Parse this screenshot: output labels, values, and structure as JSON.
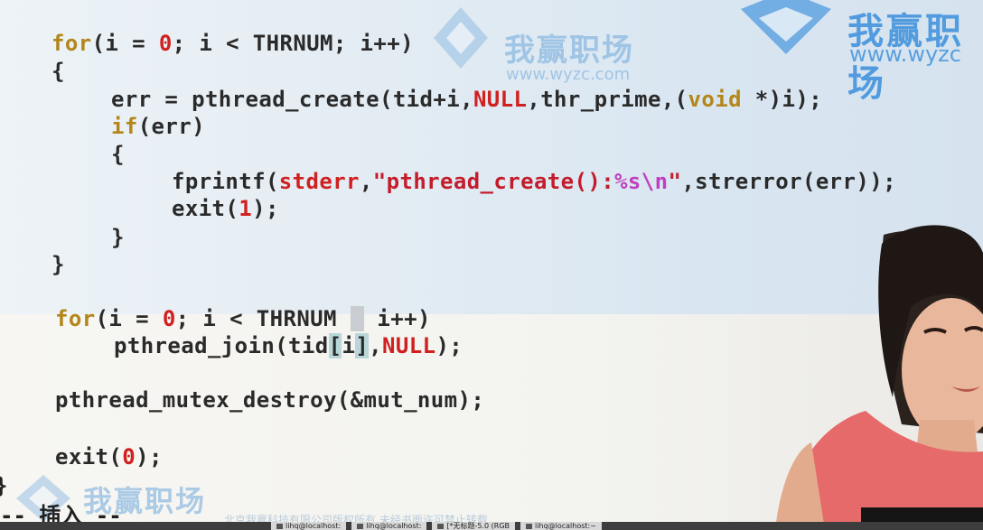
{
  "code_lines": {
    "l1": {
      "a": "for",
      "b": "(i = ",
      "c": "0",
      "d": "; i < THRNUM; i++)"
    },
    "l2": {
      "a": "{"
    },
    "l3": {
      "a": "err = pthread_create(tid+i,",
      "b": "NULL",
      "c": ",thr_prime,(",
      "d": "void",
      "e": " *)i);"
    },
    "l4": {
      "a": "if",
      "b": "(err)"
    },
    "l5": {
      "a": "{"
    },
    "l6": {
      "a": "fprintf(",
      "b": "stderr",
      "c": ",",
      "d": "\"pthread_create():",
      "e": "%s\\n",
      "f": "\"",
      "g": ",strerror(err));"
    },
    "l7": {
      "a": "exit(",
      "b": "1",
      "c": ");"
    },
    "l8": {
      "a": "}"
    },
    "l9": {
      "a": "}"
    },
    "l10": {
      "a": "for",
      "b": "(i = ",
      "c": "0",
      "d": "; i < THRNUM ",
      "e": ";",
      "f": " i++)"
    },
    "l11": {
      "a": "pthread_join(tid",
      "b": "[",
      "c": "i",
      "d": "]",
      "e": ",",
      "f": "NULL",
      "g": ");"
    },
    "l12": {
      "a": "pthread_mutex_destroy(&mut_num);"
    },
    "l13": {
      "a": "exit(",
      "b": "0",
      "c": ");"
    },
    "l14": {
      "a": "}"
    }
  },
  "status": {
    "mode": "-- 插入 --"
  },
  "watermark": {
    "brand": "我赢职场",
    "url": "www.wyzc.com",
    "url_partial": "www.wyzc",
    "copyright": "北京我赢科技有限公司版权所有 未经书面许可禁止转载"
  },
  "taskbar": {
    "items": [
      "lihq@localhost:",
      "lihq@localhost:",
      "[*无标题-5.0 (RGB",
      "lihq@localhost:~"
    ]
  },
  "colors": {
    "keyword": "#b4861a",
    "number": "#d02020",
    "string": "#c41c2c",
    "escape": "#bf3fbf",
    "watermark": "#6fa8dc"
  }
}
